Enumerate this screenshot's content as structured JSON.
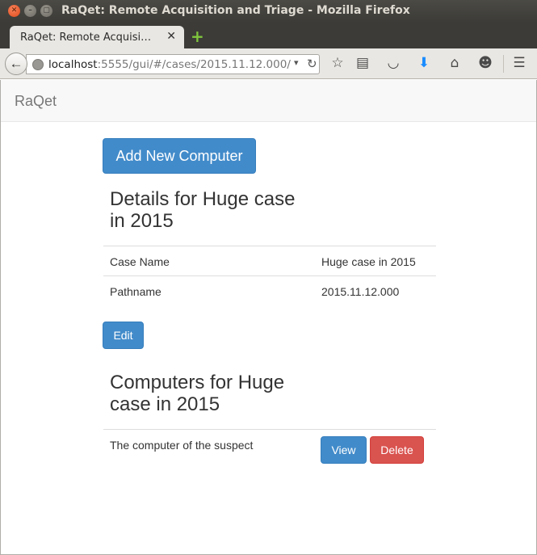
{
  "window": {
    "title": "RaQet: Remote Acquisition and Triage - Mozilla Firefox",
    "close_glyph": "✕",
    "min_glyph": "–",
    "max_glyph": "▢"
  },
  "tabs": [
    {
      "label": "RaQet: Remote Acquisi…",
      "close": "✕"
    }
  ],
  "new_tab_glyph": "+",
  "toolbar": {
    "back_glyph": "←",
    "url_host": "localhost",
    "url_rest": ":5555/gui/#/cases/2015.11.12.000/",
    "dropdown_glyph": "▾",
    "reload_glyph": "↻",
    "icons": [
      {
        "name": "bookmark-star-icon",
        "glyph": "☆"
      },
      {
        "name": "reader-list-icon",
        "glyph": "▤"
      },
      {
        "name": "pocket-icon",
        "glyph": "◡"
      },
      {
        "name": "downloads-icon",
        "glyph": "⬇"
      },
      {
        "name": "home-icon",
        "glyph": "⌂"
      },
      {
        "name": "hello-chat-icon",
        "glyph": "☻"
      },
      {
        "name": "menu-icon",
        "glyph": "☰"
      }
    ],
    "download_color": "#1a8cff"
  },
  "app": {
    "brand": "RaQet",
    "add_computer_label": "Add New Computer",
    "details_heading_line1": "Details for Huge case",
    "details_heading_line2": "in 2015",
    "details_rows": [
      {
        "label": "Case Name",
        "value": "Huge case in 2015"
      },
      {
        "label": "Pathname",
        "value": "2015.11.12.000"
      }
    ],
    "edit_label": "Edit",
    "computers_heading_line1": "Computers for Huge",
    "computers_heading_line2": "case in 2015",
    "computers": [
      {
        "name": "The computer of the suspect",
        "view_label": "View",
        "delete_label": "Delete"
      }
    ]
  },
  "colors": {
    "primary": "#428bca",
    "danger": "#d9534f"
  }
}
